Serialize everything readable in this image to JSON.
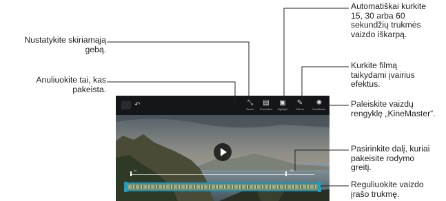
{
  "callouts": {
    "resolution": "Nustatykite skiriamąją\ngebą.",
    "undo": "Anuliuokite tai, kas\npakeista.",
    "highlight": "Automatiškai kurkite\n15, 30 arba 60\nsekundžių trukmės\nvaizdo iškarpą.",
    "effects": "Kurkite filmą\ntaikydami įvairius\nefektus.",
    "kinemaster": "Paleiskite vaizdų\nrengyklę „KineMaster“.",
    "speed": "Pasirinkite dalį, kuriai\npakeisite rodymo\ngreitį.",
    "trim": "Reguliuokite vaizdo\nįrašo trukmę."
  },
  "toolbar": {
    "tools": [
      {
        "label": "Resize",
        "icon": "resize-icon"
      },
      {
        "label": "Resolution",
        "icon": "resolution-icon"
      },
      {
        "label": "Highlight",
        "icon": "highlight-icon"
      },
      {
        "label": "Effects",
        "icon": "effects-icon"
      },
      {
        "label": "KineMaster",
        "icon": "kinemaster-icon"
      }
    ],
    "undo_icon": "undo-icon"
  },
  "playback": {
    "play_icon": "play-icon"
  },
  "speed_markers": {
    "left": "1x",
    "right": "1/8x"
  },
  "colors": {
    "accent": "#1b93b9",
    "leader": "#222222"
  }
}
